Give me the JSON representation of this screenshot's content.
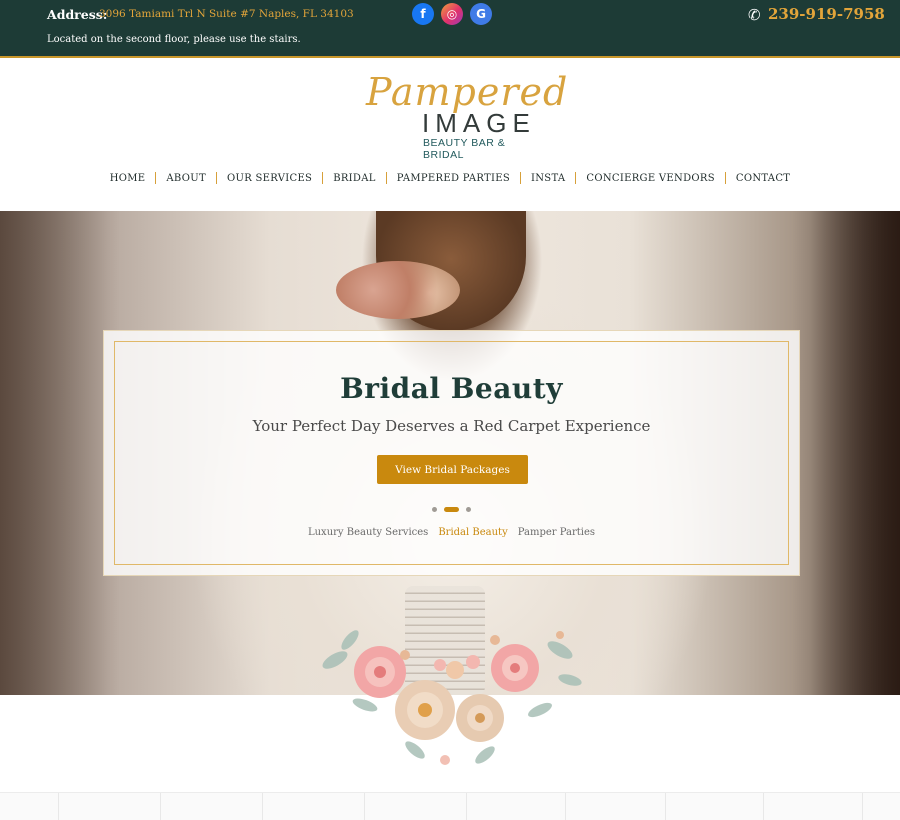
{
  "topbar": {
    "address_label": "Address:",
    "address_value": "3096 Tamiami Trl N Suite #7 Naples, FL 34103",
    "address_note": "Located on the second floor, please use the stairs.",
    "social": {
      "facebook": "f",
      "instagram": "◎",
      "google": "G"
    },
    "phone": "239-919-7958",
    "colors": {
      "background": "#1d3b36",
      "accent": "#e3a53a"
    }
  },
  "logo": {
    "script": "Pampered",
    "main": "IMAGE",
    "sub": "BEAUTY BAR & BRIDAL"
  },
  "nav": {
    "items": [
      "HOME",
      "ABOUT",
      "OUR SERVICES",
      "BRIDAL",
      "PAMPERED PARTIES",
      "INSTA",
      "CONCIERGE VENDORS",
      "CONTACT"
    ]
  },
  "slider": {
    "title": "Bridal Beauty",
    "subtitle": "Your Perfect Day Deserves a Red Carpet Experience",
    "button_label": "View Bridal Packages",
    "active_slide": 2,
    "tabs": [
      "Luxury Beauty Services",
      "Bridal Beauty",
      "Pamper Parties"
    ],
    "colors": {
      "button": "#c9890e",
      "frame": "#e0b868"
    }
  }
}
